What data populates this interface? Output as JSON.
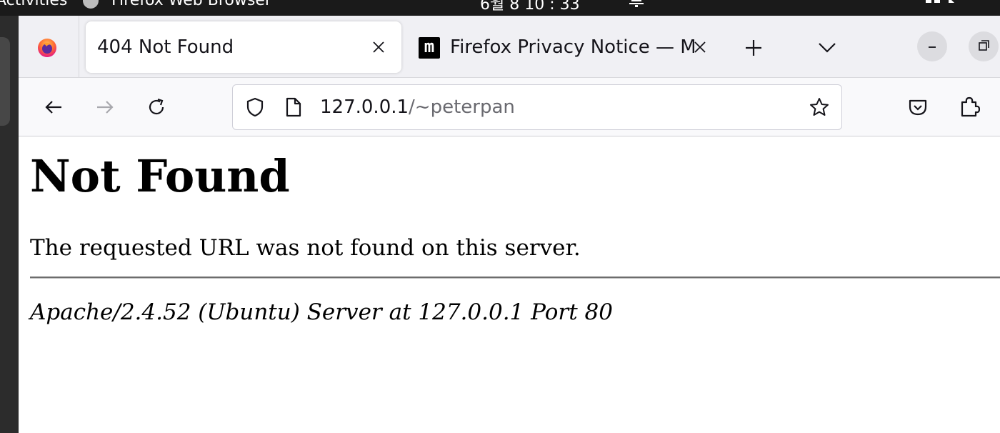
{
  "topbar": {
    "activities": "Activities",
    "app_name": "Firefox Web Browser",
    "clock": "6월 8 10 : 33"
  },
  "tabs": [
    {
      "label": "404 Not Found",
      "active": true
    },
    {
      "label": "Firefox Privacy Notice — Mozilla",
      "active": false,
      "favicon": "m"
    }
  ],
  "navbar": {
    "url_host": "127.0.0.1",
    "url_path": "/~peterpan"
  },
  "page": {
    "heading": "Not Found",
    "message": "The requested URL was not found on this server.",
    "server_signature": "Apache/2.4.52 (Ubuntu) Server at 127.0.0.1 Port 80"
  },
  "icons": {
    "firefox_view": "firefox-logo-icon",
    "tab_close": "close-icon",
    "new_tab": "plus-icon",
    "tab_list": "chevron-down-icon",
    "minimize": "minimize-icon",
    "maximize": "maximize-icon",
    "back": "arrow-left-icon",
    "forward": "arrow-right-icon",
    "reload": "reload-icon",
    "tracking": "shield-icon",
    "site_info": "page-icon",
    "bookmark": "star-icon",
    "pocket": "pocket-icon",
    "extensions": "puzzle-icon"
  },
  "colors": {
    "tabstrip_bg": "#f0f0f4",
    "navbar_bg": "#f9f9fb",
    "url_path": "#6a6a70",
    "topbar_bg": "#1a1a1a"
  }
}
